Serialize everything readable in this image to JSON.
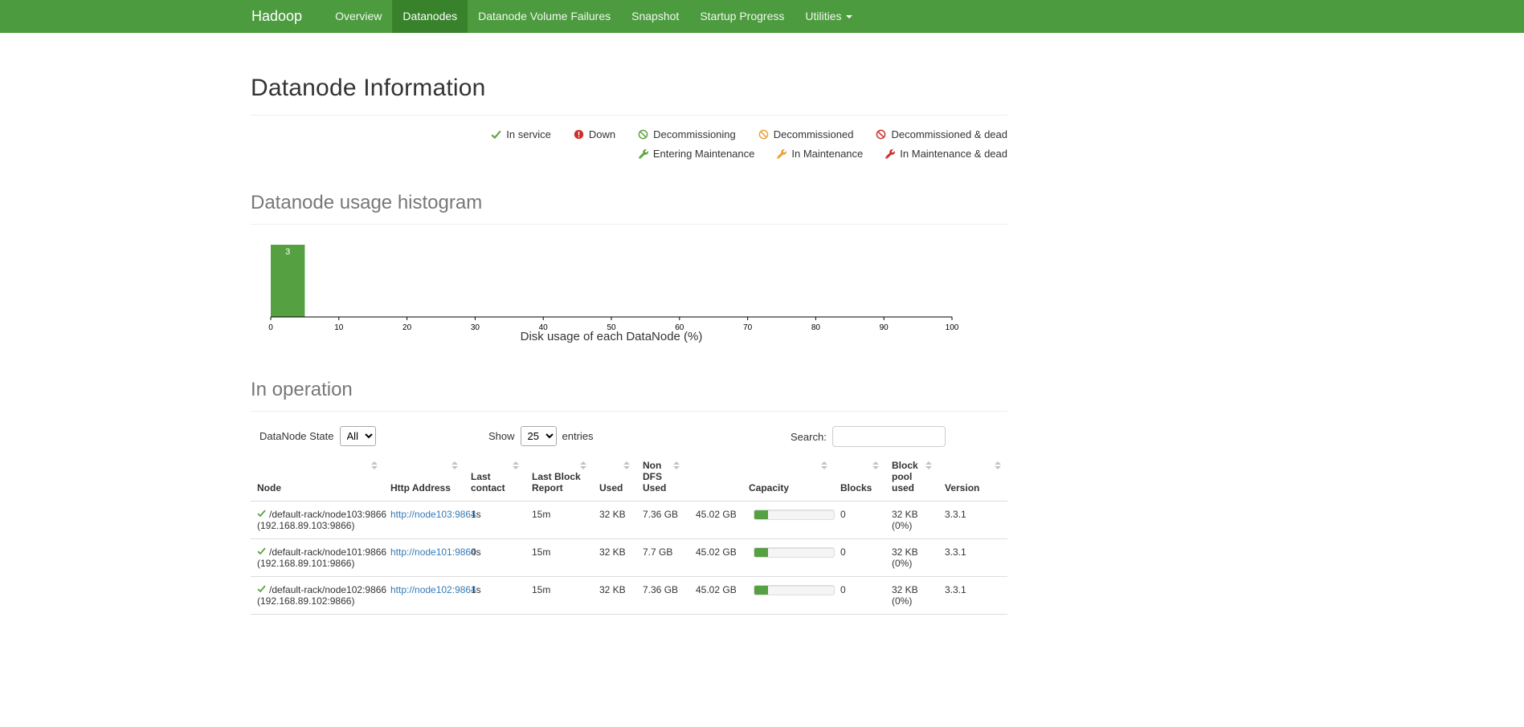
{
  "navbar": {
    "brand": "Hadoop",
    "items": [
      {
        "label": "Overview"
      },
      {
        "label": "Datanodes"
      },
      {
        "label": "Datanode Volume Failures"
      },
      {
        "label": "Snapshot"
      },
      {
        "label": "Startup Progress"
      },
      {
        "label": "Utilities"
      }
    ]
  },
  "page_title": "Datanode Information",
  "legend": {
    "in_service": "In service",
    "down": "Down",
    "decommissioning": "Decommissioning",
    "decommissioned": "Decommissioned",
    "decommissioned_dead": "Decommissioned & dead",
    "entering_maintenance": "Entering Maintenance",
    "in_maintenance": "In Maintenance",
    "in_maintenance_dead": "In Maintenance & dead"
  },
  "sections": {
    "histogram_heading": "Datanode usage histogram",
    "operation_heading": "In operation"
  },
  "chart_data": {
    "type": "bar",
    "title": "Datanode usage histogram",
    "xlabel": "Disk usage of each DataNode (%)",
    "ylabel": "",
    "x_range": [
      0,
      100
    ],
    "x_ticks": [
      0,
      10,
      20,
      30,
      40,
      50,
      60,
      70,
      80,
      90,
      100
    ],
    "bars": [
      {
        "x0": 0,
        "x1": 5,
        "value": 3,
        "label": "3"
      }
    ],
    "grid": false,
    "bar_color": "#55A041"
  },
  "controls": {
    "state_label": "DataNode State",
    "state_value": "All",
    "show_label": "Show",
    "show_value": "25",
    "entries_label": "entries",
    "search_label": "Search:",
    "search_value": ""
  },
  "table": {
    "headers": [
      "Node",
      "Http Address",
      "Last contact",
      "Last Block Report",
      "Used",
      "Non DFS Used",
      "Capacity",
      "Blocks",
      "Block pool used",
      "Version"
    ],
    "rows": [
      {
        "node": "/default-rack/node103:9866",
        "node_ip": "(192.168.89.103:9866)",
        "http_address": "http://node103:9864",
        "last_contact": "1s",
        "last_block_report": "15m",
        "used": "32 KB",
        "non_dfs_used": "7.36 GB",
        "capacity": "45.02 GB",
        "capacity_used_pct": 17,
        "blocks": "0",
        "block_pool_used": "32 KB (0%)",
        "version": "3.3.1"
      },
      {
        "node": "/default-rack/node101:9866",
        "node_ip": "(192.168.89.101:9866)",
        "http_address": "http://node101:9864",
        "last_contact": "0s",
        "last_block_report": "15m",
        "used": "32 KB",
        "non_dfs_used": "7.7 GB",
        "capacity": "45.02 GB",
        "capacity_used_pct": 17,
        "blocks": "0",
        "block_pool_used": "32 KB (0%)",
        "version": "3.3.1"
      },
      {
        "node": "/default-rack/node102:9866",
        "node_ip": "(192.168.89.102:9866)",
        "http_address": "http://node102:9864",
        "last_contact": "1s",
        "last_block_report": "15m",
        "used": "32 KB",
        "non_dfs_used": "7.36 GB",
        "capacity": "45.02 GB",
        "capacity_used_pct": 17,
        "blocks": "0",
        "block_pool_used": "32 KB (0%)",
        "version": "3.3.1"
      }
    ]
  },
  "colors": {
    "navbar_bg": "#4C9B3F",
    "navbar_active_bg": "#38822C",
    "icon_green": "#5FA341",
    "icon_orange": "#E9A135",
    "icon_red": "#C9302C",
    "bar_green": "#55A041",
    "link_blue": "#337AB7"
  }
}
